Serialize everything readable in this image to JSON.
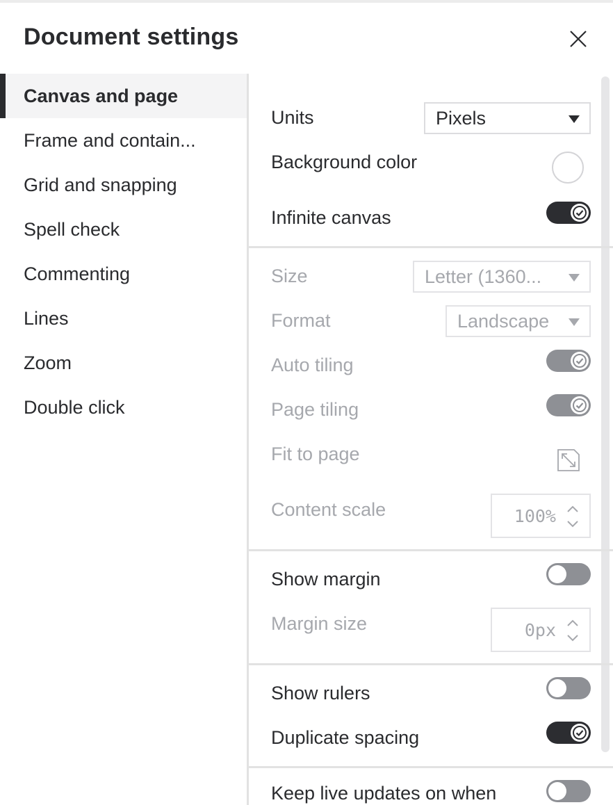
{
  "dialog": {
    "title": "Document settings",
    "close_icon": "close-icon"
  },
  "sidebar": {
    "items": [
      {
        "label": "Canvas and page",
        "active": true
      },
      {
        "label": "Frame and contain..."
      },
      {
        "label": "Grid and snapping"
      },
      {
        "label": "Spell check"
      },
      {
        "label": "Commenting"
      },
      {
        "label": "Lines"
      },
      {
        "label": "Zoom"
      },
      {
        "label": "Double click"
      }
    ]
  },
  "settings": {
    "units": {
      "label": "Units",
      "value": "Pixels"
    },
    "background_color": {
      "label": "Background color",
      "value": "#ffffff"
    },
    "infinite_canvas": {
      "label": "Infinite canvas",
      "on": true
    },
    "size": {
      "label": "Size",
      "value": "Letter (1360...",
      "disabled": true
    },
    "format": {
      "label": "Format",
      "value": "Landscape",
      "disabled": true
    },
    "auto_tiling": {
      "label": "Auto tiling",
      "on": true,
      "disabled": true
    },
    "page_tiling": {
      "label": "Page tiling",
      "on": true,
      "disabled": true
    },
    "fit_to_page": {
      "label": "Fit to page",
      "icon": "expand-diagonal-icon",
      "disabled": true
    },
    "content_scale": {
      "label": "Content scale",
      "value": "100%",
      "disabled": true
    },
    "show_margin": {
      "label": "Show margin",
      "on": false
    },
    "margin_size": {
      "label": "Margin size",
      "value": "0px",
      "disabled": true
    },
    "show_rulers": {
      "label": "Show rulers",
      "on": false
    },
    "duplicate_spacing": {
      "label": "Duplicate spacing",
      "on": true
    },
    "keep_live_updates": {
      "label": "Keep live updates on when",
      "on": false
    }
  },
  "colors": {
    "text": "#2a2b2e",
    "disabled_text": "#a6a8ad",
    "toggle_on": "#2c2d31",
    "toggle_off": "#8e9095",
    "divider": "#e2e2e2"
  }
}
